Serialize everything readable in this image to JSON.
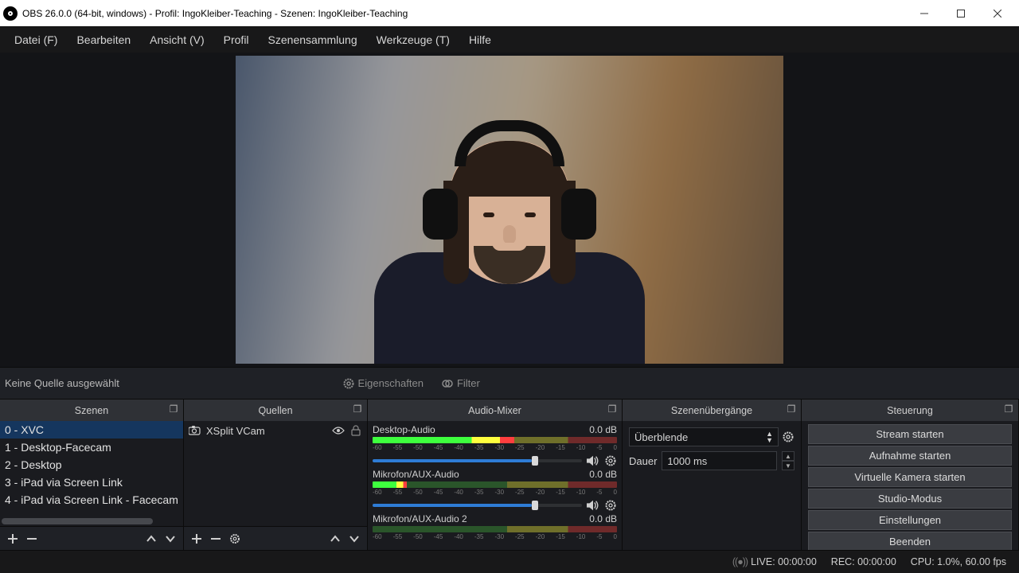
{
  "window": {
    "title": "OBS 26.0.0 (64-bit, windows) - Profil: IngoKleiber-Teaching - Szenen: IngoKleiber-Teaching"
  },
  "menu": [
    "Datei (F)",
    "Bearbeiten",
    "Ansicht (V)",
    "Profil",
    "Szenensammlung",
    "Werkzeuge (T)",
    "Hilfe"
  ],
  "sourcebar": {
    "no_source": "Keine Quelle ausgewählt",
    "properties": "Eigenschaften",
    "filters": "Filter"
  },
  "docks": {
    "scenes": {
      "title": "Szenen",
      "items": [
        "0 - XVC",
        "1 - Desktop-Facecam",
        "2 - Desktop",
        "3 - iPad via Screen Link",
        "4 - iPad via Screen Link - Facecam"
      ]
    },
    "sources": {
      "title": "Quellen",
      "items": [
        {
          "name": "XSplit VCam"
        }
      ]
    },
    "mixer": {
      "title": "Audio-Mixer",
      "channels": [
        {
          "name": "Desktop-Audio",
          "db": "0.0 dB",
          "fill": 58
        },
        {
          "name": "Mikrofon/AUX-Audio",
          "db": "0.0 dB",
          "fill": 14
        },
        {
          "name": "Mikrofon/AUX-Audio 2",
          "db": "0.0 dB",
          "fill": 0
        }
      ],
      "ticks": [
        "-60",
        "-55",
        "-50",
        "-45",
        "-40",
        "-35",
        "-30",
        "-25",
        "-20",
        "-15",
        "-10",
        "-5",
        "0"
      ]
    },
    "transitions": {
      "title": "Szenenübergänge",
      "type": "Überblende",
      "duration_label": "Dauer",
      "duration": "1000 ms"
    },
    "controls": {
      "title": "Steuerung",
      "buttons": [
        "Stream starten",
        "Aufnahme starten",
        "Virtuelle Kamera starten",
        "Studio-Modus",
        "Einstellungen",
        "Beenden"
      ]
    }
  },
  "status": {
    "live": "LIVE: 00:00:00",
    "rec": "REC: 00:00:00",
    "cpu": "CPU: 1.0%, 60.00 fps"
  }
}
